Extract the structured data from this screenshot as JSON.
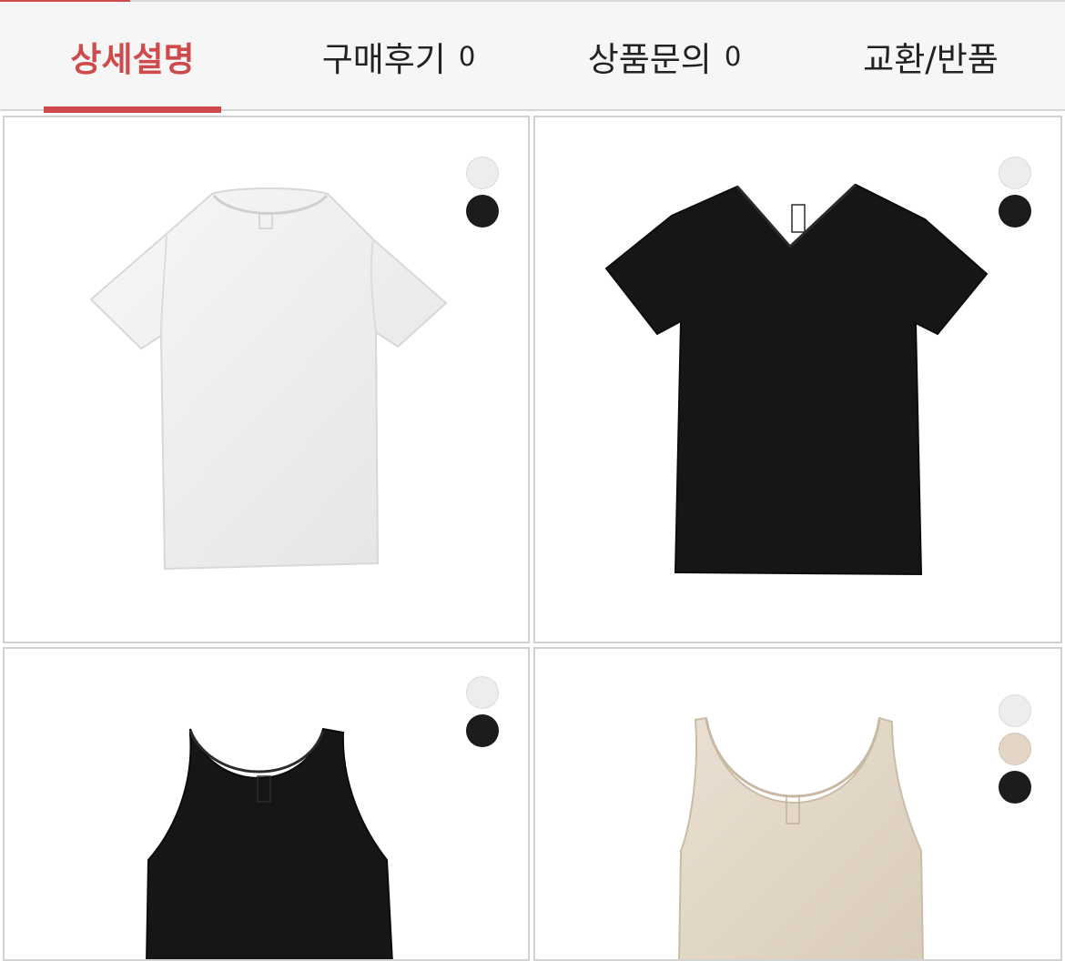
{
  "tabs": [
    {
      "label": "상세설명",
      "count": ""
    },
    {
      "label": "구매후기",
      "count": "0"
    },
    {
      "label": "상품문의",
      "count": "0"
    },
    {
      "label": "교환/반품",
      "count": ""
    }
  ],
  "colors": {
    "accent": "#cf4a4a",
    "white": "#eeeeee",
    "black": "#1c1c1e",
    "beige": "#e3d6c6"
  },
  "products": [
    {
      "icon": "white-crew-neck-tshirt-icon",
      "swatches": [
        "#ededed",
        "#1c1c1e"
      ]
    },
    {
      "icon": "black-v-neck-tshirt-icon",
      "swatches": [
        "#ededed",
        "#1c1c1e"
      ]
    },
    {
      "icon": "black-tank-top-icon",
      "swatches": [
        "#ededed",
        "#1c1c1e"
      ]
    },
    {
      "icon": "beige-tank-top-icon",
      "swatches": [
        "#ededed",
        "#e3d6c6",
        "#1c1c1e"
      ]
    }
  ]
}
